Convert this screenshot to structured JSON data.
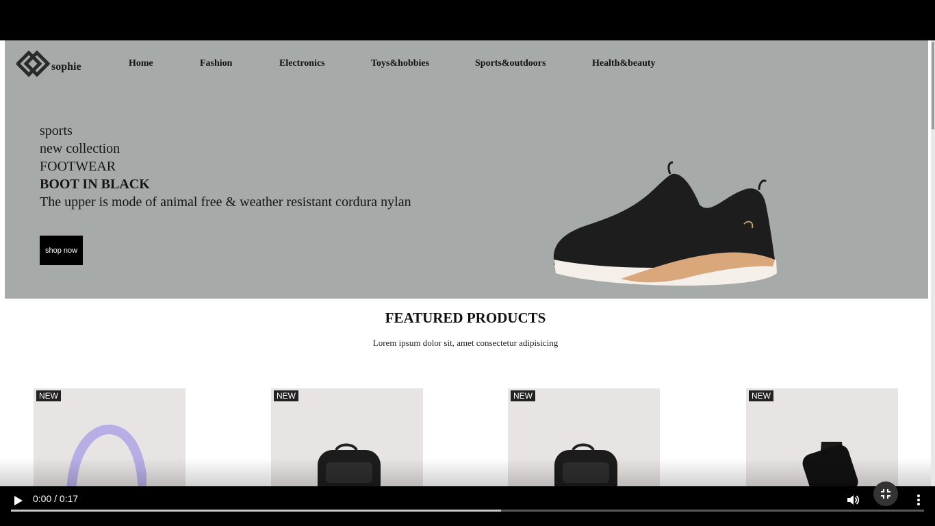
{
  "site": {
    "logo_text": "sophie",
    "nav": [
      "Home",
      "Fashion",
      "Electronics",
      "Toys&hobbies",
      "Sports&outdoors",
      "Health&beauty"
    ]
  },
  "hero": {
    "line1": "sports",
    "line2": "new collection",
    "line3": "FOOTWEAR",
    "line4": "BOOT IN BLACK",
    "line5": "The upper is mode of animal free & weather resistant cordura nylan",
    "shop_label": "shop now"
  },
  "featured": {
    "title": "FEATURED PRODUCTS",
    "subtitle": "Lorem ipsum dolor sit, amet consectetur adipisicing",
    "cards": [
      {
        "badge": "NEW",
        "icon": "headband-icon"
      },
      {
        "badge": "NEW",
        "icon": "backpack-icon"
      },
      {
        "badge": "NEW",
        "icon": "backpack-icon"
      },
      {
        "badge": "NEW",
        "icon": "smartwatch-icon"
      }
    ]
  },
  "player": {
    "time": "0:00 / 0:17",
    "progress_buffered": 0.537
  },
  "colors": {
    "hero_bg": "#a6aaa9",
    "card_bg": "#e8e4e3",
    "accent_shoe_sole": "#d9a77a"
  }
}
